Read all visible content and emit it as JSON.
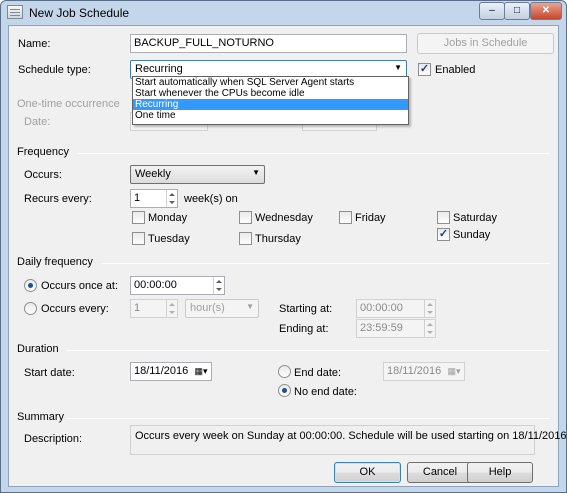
{
  "window": {
    "title": "New Job Schedule",
    "minimize": "–",
    "maximize": "□",
    "close": "✕"
  },
  "name": {
    "label": "Name:",
    "value": "BACKUP_FULL_NOTURNO",
    "jobs_button": "Jobs in Schedule"
  },
  "schedule_type": {
    "label": "Schedule type:",
    "selected": "Recurring",
    "options": [
      "Start automatically when SQL Server Agent starts",
      "Start whenever the CPUs become idle",
      "Recurring",
      "One time"
    ],
    "enabled_label": "Enabled",
    "enabled_checked": true
  },
  "one_time": {
    "header": "One-time occurrence",
    "date_label": "Date:"
  },
  "frequency": {
    "header": "Frequency",
    "occurs_label": "Occurs:",
    "occurs_value": "Weekly",
    "recurs_label": "Recurs every:",
    "recurs_value": "1",
    "recurs_unit": "week(s) on",
    "days": [
      {
        "label": "Monday",
        "checked": false
      },
      {
        "label": "Wednesday",
        "checked": false
      },
      {
        "label": "Friday",
        "checked": false
      },
      {
        "label": "Saturday",
        "checked": false
      },
      {
        "label": "Tuesday",
        "checked": false
      },
      {
        "label": "Thursday",
        "checked": false
      },
      {
        "label": "Sunday",
        "checked": true
      }
    ]
  },
  "daily": {
    "header": "Daily frequency",
    "once_label": "Occurs once at:",
    "once_value": "00:00:00",
    "every_label": "Occurs every:",
    "every_value": "1",
    "every_unit": "hour(s)",
    "starting_label": "Starting at:",
    "starting_value": "00:00:00",
    "ending_label": "Ending at:",
    "ending_value": "23:59:59"
  },
  "duration": {
    "header": "Duration",
    "start_label": "Start date:",
    "start_value": "18/11/2016",
    "end_label": "End date:",
    "end_value": "18/11/2016",
    "noend_label": "No end date:"
  },
  "summary": {
    "header": "Summary",
    "desc_label": "Description:",
    "text": "Occurs every week on Sunday at 00:00:00. Schedule will be used starting on 18/11/2016."
  },
  "buttons": {
    "ok": "OK",
    "cancel": "Cancel",
    "help": "Help"
  },
  "icons": {
    "check": "✓",
    "arrow": "▼",
    "calendar": "▦▾"
  }
}
